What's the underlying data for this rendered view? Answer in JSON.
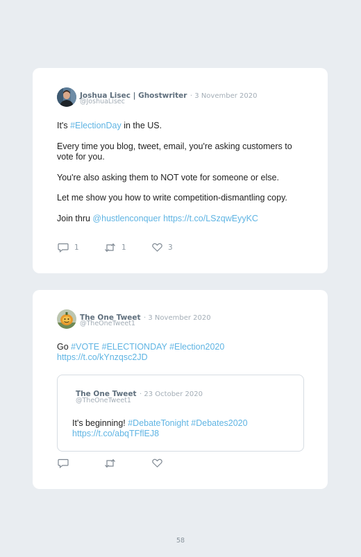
{
  "tweet1": {
    "author_name": "Joshua Lisec | Ghostwriter",
    "date": "· 3 November 2020",
    "handle": "@JoshuaLisec",
    "p1_pre": "It's ",
    "p1_tag": "#ElectionDay",
    "p1_post": " in the US.",
    "p2": "Every time you blog, tweet, email, you're asking customers to vote for you.",
    "p3": "You're also asking them to NOT vote for someone or else.",
    "p4": "Let me show you how to write competition-dismantling copy.",
    "p5_pre": "Join thru ",
    "p5_mention": "@hustlenconquer",
    "p5_link": "https://t.co/LSzqwEyyKC",
    "replies": "1",
    "retweets": "1",
    "likes": "3"
  },
  "tweet2": {
    "author_name": "The One Tweet",
    "date": "· 3 November 2020",
    "handle": "@TheOneTweet1",
    "text_pre": "Go ",
    "tags": "#VOTE #ELECTIONDAY #Election2020",
    "link": "https://t.co/kYnzqsc2JD",
    "quoted": {
      "author_name": "The One Tweet",
      "date": "· 23 October 2020",
      "handle": "@TheOneTweet1",
      "text_pre": "It's beginning! ",
      "tags": "#DebateTonight #Debates2020",
      "link": "https://t.co/abqTFflEJ8"
    }
  },
  "icons": {
    "reply": "reply-icon",
    "retweet": "retweet-icon",
    "like": "heart-icon"
  },
  "colors": {
    "link": "#5fb4e3",
    "name": "#5f6f7d",
    "meta": "#a3adb6",
    "background": "#e9edf1"
  },
  "page_number": "58"
}
